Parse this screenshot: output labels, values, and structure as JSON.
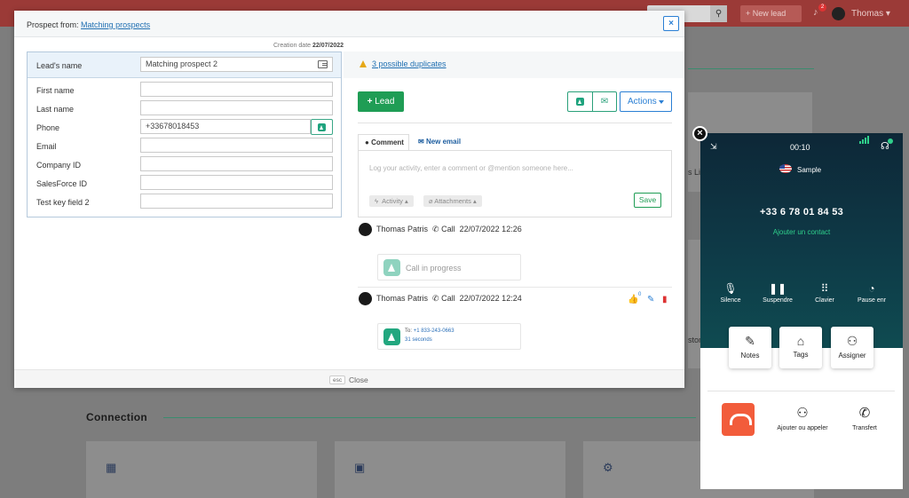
{
  "background": {
    "user_name": "Thomas",
    "new_lead_label": "+ New lead",
    "notification_count": "2",
    "section_title": "Connection",
    "side_text_1": "s Lin",
    "side_text_2": "stom"
  },
  "modal": {
    "prospect_from_label": "Prospect from:",
    "prospect_from_link": "Matching prospects",
    "close_icon": "×",
    "creation_label": "Creation date",
    "creation_date": "22/07/2022",
    "form": {
      "lead_name_label": "Lead's name",
      "lead_name_value": "Matching prospect 2",
      "fields": [
        {
          "label": "First name",
          "value": ""
        },
        {
          "label": "Last name",
          "value": ""
        },
        {
          "label": "Phone",
          "value": "+33678018453"
        },
        {
          "label": "Email",
          "value": ""
        },
        {
          "label": "Company ID",
          "value": ""
        },
        {
          "label": "SalesForce ID",
          "value": ""
        },
        {
          "label": "Test key field 2",
          "value": ""
        }
      ]
    },
    "duplicates_link": "3 possible duplicates",
    "lead_button": "Lead",
    "actions_button": "Actions",
    "tabs": {
      "comment": "Comment",
      "new_email": "New email"
    },
    "comment_placeholder": "Log your activity, enter a comment or @mention someone here...",
    "activity_chip": "Activity",
    "attachments_chip": "Attachments",
    "save_button": "Save",
    "activities": [
      {
        "user": "Thomas Patris",
        "type": "Call",
        "datetime": "22/07/2022 12:26",
        "status": "Call in progress"
      },
      {
        "user": "Thomas Patris",
        "type": "Call",
        "datetime": "22/07/2022 12:24",
        "to_label": "To:",
        "to_number": "+1 833-243-0663",
        "duration": "31 seconds",
        "likes": "0"
      }
    ],
    "esc_key": "esc",
    "close_label": "Close"
  },
  "dialer": {
    "timer": "00:10",
    "contact_name": "Sample",
    "number": "+33 6 78 01 84 53",
    "add_contact": "Ajouter un contact",
    "controls": [
      "Silence",
      "Suspendre",
      "Clavier",
      "Pause enr"
    ],
    "tiles": [
      "Notes",
      "Tags",
      "Assigner"
    ],
    "actions": [
      "Ajouter ou appeler",
      "Transfert"
    ]
  },
  "colors": {
    "primary_green": "#1f9d55",
    "link_blue": "#1f6fb2",
    "dialer_dark": "#0d2737",
    "hangup_red": "#f25c3b",
    "dialer_accent": "#2fd08b"
  }
}
